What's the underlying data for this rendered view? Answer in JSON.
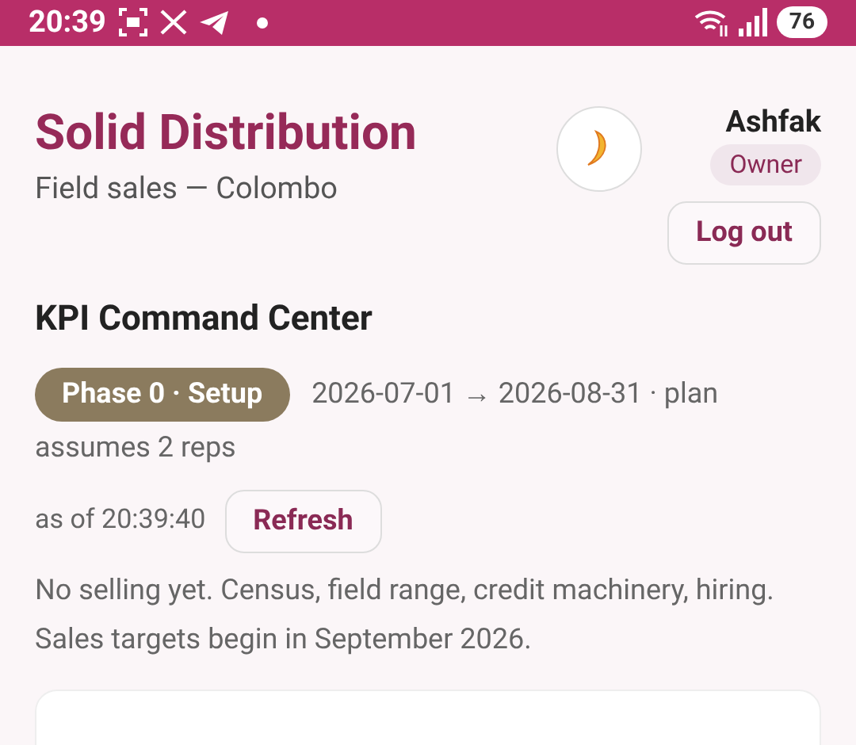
{
  "status_bar": {
    "time": "20:39",
    "battery": "76"
  },
  "header": {
    "title": "Solid Distribution",
    "subtitle": "Field sales — Colombo",
    "user": "Ashfak",
    "role": "Owner",
    "logout": "Log out"
  },
  "section": {
    "title": "KPI Command Center",
    "phase": "Phase 0 · Setup",
    "range_lines": [
      "2026-07-01 → 2026-08-31 · plan",
      "assumes 2 reps"
    ],
    "as_of": "as of 20:39:40",
    "refresh": "Refresh",
    "note": "No selling yet. Census, field range, credit machinery, hiring. Sales targets begin in September 2026."
  }
}
